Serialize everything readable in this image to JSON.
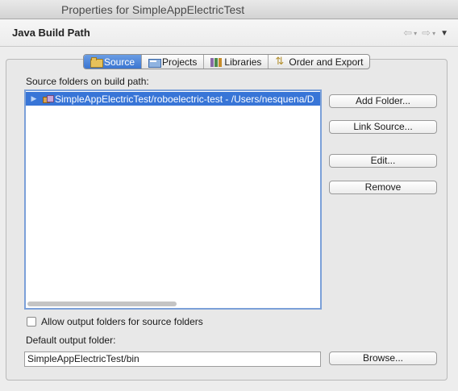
{
  "window": {
    "title": "Properties for SimpleAppElectricTest"
  },
  "header": {
    "title": "Java Build Path",
    "nav_back": "⇦",
    "nav_back_chevron": "▾",
    "nav_forward": "⇨",
    "nav_forward_chevron": "▾",
    "view_menu": "▼"
  },
  "tabs": [
    {
      "label": "Source",
      "icon": "source-folder-icon",
      "active": true
    },
    {
      "label": "Projects",
      "icon": "projects-icon",
      "active": false
    },
    {
      "label": "Libraries",
      "icon": "libraries-icon",
      "active": false
    },
    {
      "label": "Order and Export",
      "icon": "order-export-icon",
      "active": false
    }
  ],
  "source": {
    "section_label": "Source folders on build path:",
    "tree": [
      {
        "label": "SimpleAppElectricTest/roboelectric-test - /Users/nesquena/D",
        "twisty": "▶",
        "selected": true
      }
    ]
  },
  "buttons": {
    "add_folder": "Add Folder...",
    "link_source": "Link Source...",
    "edit": "Edit...",
    "remove": "Remove",
    "browse": "Browse..."
  },
  "output": {
    "allow_folders_label": "Allow output folders for source folders",
    "allow_folders_checked": false,
    "default_label": "Default output folder:",
    "default_value": "SimpleAppElectricTest/bin"
  },
  "colors": {
    "selection": "#3875d7",
    "active_tab": "#3a75d1",
    "focus_border": "#7ba0d8"
  }
}
